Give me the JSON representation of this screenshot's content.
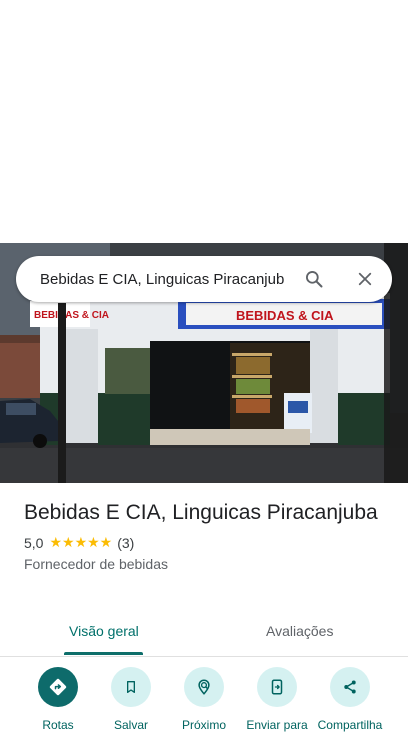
{
  "search": {
    "query": "Bebidas E CIA, Linguicas Piracanjub"
  },
  "photo": {
    "sign_text": "BEBIDAS & CIA",
    "sign_left_text": "BEBIDAS & CIA"
  },
  "place": {
    "title": "Bebidas E CIA, Linguicas Piracanjuba",
    "rating": "5,0",
    "stars": "★★★★★",
    "review_count": "(3)",
    "category": "Fornecedor de bebidas"
  },
  "tabs": [
    {
      "label": "Visão geral"
    },
    {
      "label": "Avaliações"
    }
  ],
  "actions": [
    {
      "label": "Rotas",
      "icon": "directions-icon"
    },
    {
      "label": "Salvar",
      "icon": "bookmark-icon"
    },
    {
      "label": "Próximo",
      "icon": "nearby-icon"
    },
    {
      "label": "Enviar para",
      "icon": "send-to-phone-icon"
    },
    {
      "label": "Compartilha",
      "icon": "share-icon"
    }
  ],
  "colors": {
    "accent": "#0e6b6b",
    "tab_active": "#00706a",
    "action_bg": "#d5f1f1",
    "star": "#fbbc04"
  }
}
